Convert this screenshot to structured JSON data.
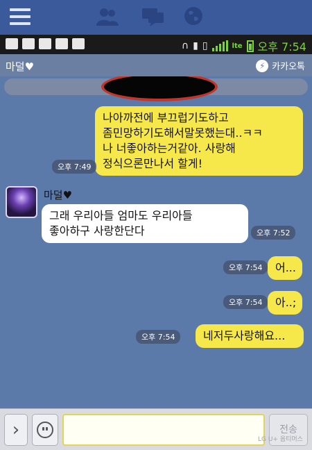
{
  "status_bar": {
    "time": "오후 7:54",
    "network": "lte"
  },
  "chat_header": {
    "title": "마덜♥",
    "brand": "카카오톡"
  },
  "messages": [
    {
      "from": "me",
      "text": "나아까전에 부끄럽기도하고\n좀민망하기도해서말못했는대..ㅋㅋ\n나 너좋아하는거같아. 사랑해\n정식으론만나서 할게!",
      "time": "오후 7:49"
    },
    {
      "from": "them",
      "sender": "마덜♥",
      "text": "그래 우리아들 엄마도 우리아들\n좋아하구 사랑한단다",
      "time": "오후 7:52"
    },
    {
      "from": "me",
      "text": "어...",
      "time": "오후 7:54"
    },
    {
      "from": "me",
      "text": "아..;",
      "time": "오후 7:54"
    },
    {
      "from": "me",
      "text": "네저두사랑해요...",
      "time": "오후 7:54"
    }
  ],
  "input_bar": {
    "expand_label": "›",
    "send_label": "전송",
    "watermark": "LG U+ 옵티머스"
  },
  "colors": {
    "my_bubble": "#f6e84a",
    "their_bubble": "#ffffff",
    "chat_bg": "#5c7aa9"
  }
}
